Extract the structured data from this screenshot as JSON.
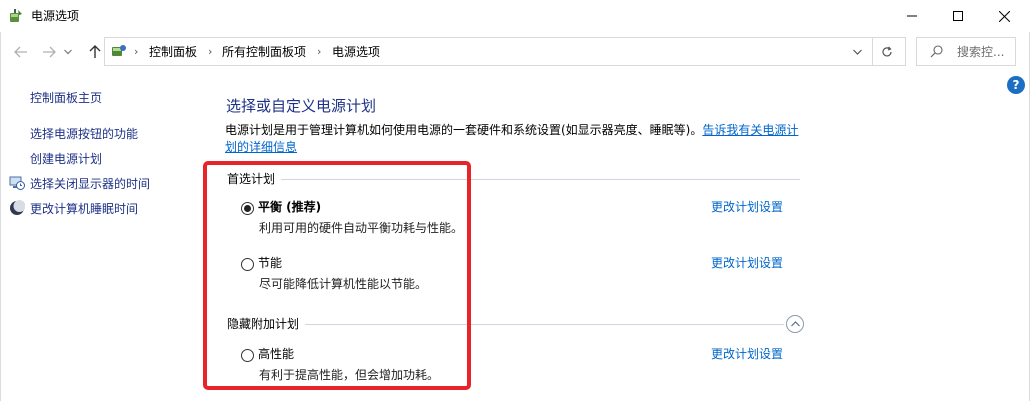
{
  "window": {
    "title": "电源选项"
  },
  "address": {
    "breadcrumb": [
      "控制面板",
      "所有控制面板项",
      "电源选项"
    ],
    "search_placeholder": "搜索控..."
  },
  "sidebar": {
    "home": "控制面板主页",
    "links": [
      {
        "label": "选择电源按钮的功能",
        "icon": ""
      },
      {
        "label": "创建电源计划",
        "icon": ""
      },
      {
        "label": "选择关闭显示器的时间",
        "icon": "monitor-clock-icon"
      },
      {
        "label": "更改计算机睡眠时间",
        "icon": "moon-icon"
      }
    ]
  },
  "main": {
    "title": "选择或自定义电源计划",
    "description": "电源计划是用于管理计算机如何使用电源的一套硬件和系统设置(如显示器亮度、睡眠等)。",
    "description_link": "告诉我有关电源计划的详细信息",
    "preferred_group": "首选计划",
    "hidden_group": "隐藏附加计划",
    "plans": [
      {
        "name": "平衡 (推荐)",
        "desc": "利用可用的硬件自动平衡功耗与性能。",
        "selected": true,
        "link": "更改计划设置"
      },
      {
        "name": "节能",
        "desc": "尽可能降低计算机性能以节能。",
        "selected": false,
        "link": "更改计划设置"
      },
      {
        "name": "高性能",
        "desc": "有利于提高性能，但会增加功耗。",
        "selected": false,
        "link": "更改计划设置"
      }
    ]
  },
  "colors": {
    "highlight": "#e8242b",
    "link": "#0066cc",
    "title": "#1e3287"
  }
}
